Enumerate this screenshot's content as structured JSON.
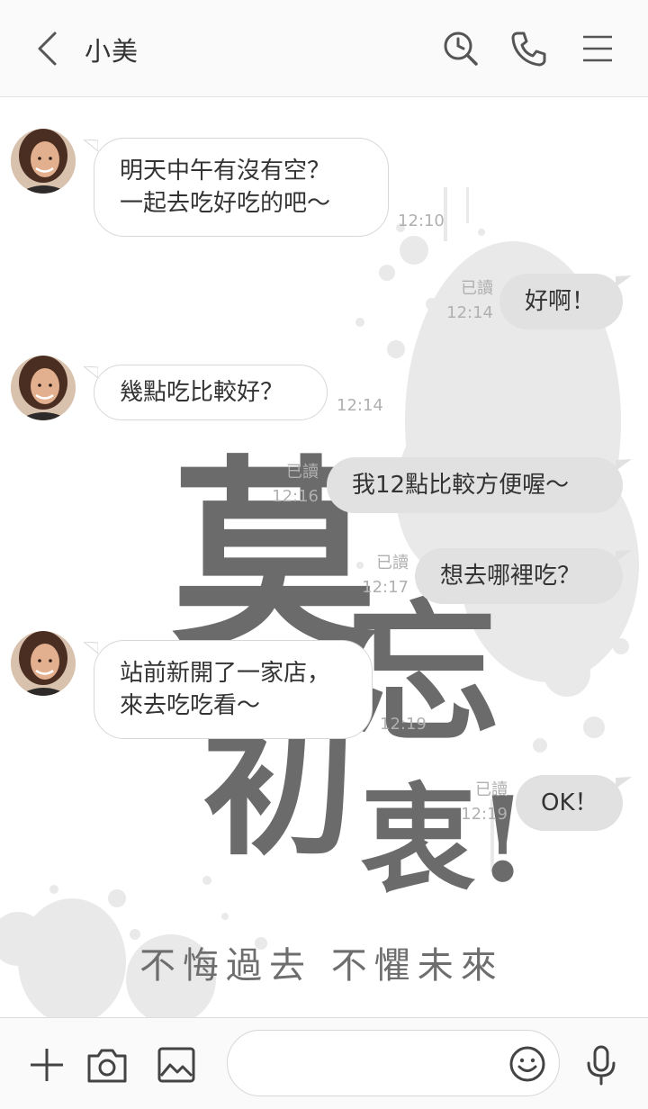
{
  "header": {
    "contact_name": "小美",
    "icons": [
      "back-arrow-icon",
      "search-history-icon",
      "phone-icon",
      "menu-icon"
    ]
  },
  "background": {
    "calligraphy": [
      "莫",
      "忘",
      "初",
      "衷!"
    ],
    "motto": "不悔過去  不懼未來"
  },
  "messages": [
    {
      "direction": "in",
      "lines": [
        "明天中午有沒有空？",
        "一起去吃好吃的吧～"
      ],
      "time": "12:10"
    },
    {
      "direction": "out",
      "lines": [
        "好啊！"
      ],
      "read": "已讀",
      "time": "12:14"
    },
    {
      "direction": "in",
      "lines": [
        "幾點吃比較好？"
      ],
      "time": "12:14"
    },
    {
      "direction": "out",
      "lines": [
        "我12點比較方便喔～"
      ],
      "read": "已讀",
      "time": "12:16"
    },
    {
      "direction": "out",
      "lines": [
        "想去哪裡吃？"
      ],
      "read": "已讀",
      "time": "12:17"
    },
    {
      "direction": "in",
      "lines": [
        "站前新開了一家店，",
        "來去吃吃看～"
      ],
      "time": "12:19"
    },
    {
      "direction": "out",
      "lines": [
        "OK！"
      ],
      "read": "已讀",
      "time": "12:19"
    }
  ],
  "footer": {
    "input_value": "",
    "icons": [
      "plus-icon",
      "camera-icon",
      "image-icon",
      "emoji-icon",
      "microphone-icon"
    ]
  },
  "colors": {
    "header_bg": "#fafafa",
    "bubble_out": "#e1e1e1",
    "bubble_in": "#ffffff",
    "calligraphy": "#6b6b6b",
    "ink_splash": "#e9e9e9"
  }
}
